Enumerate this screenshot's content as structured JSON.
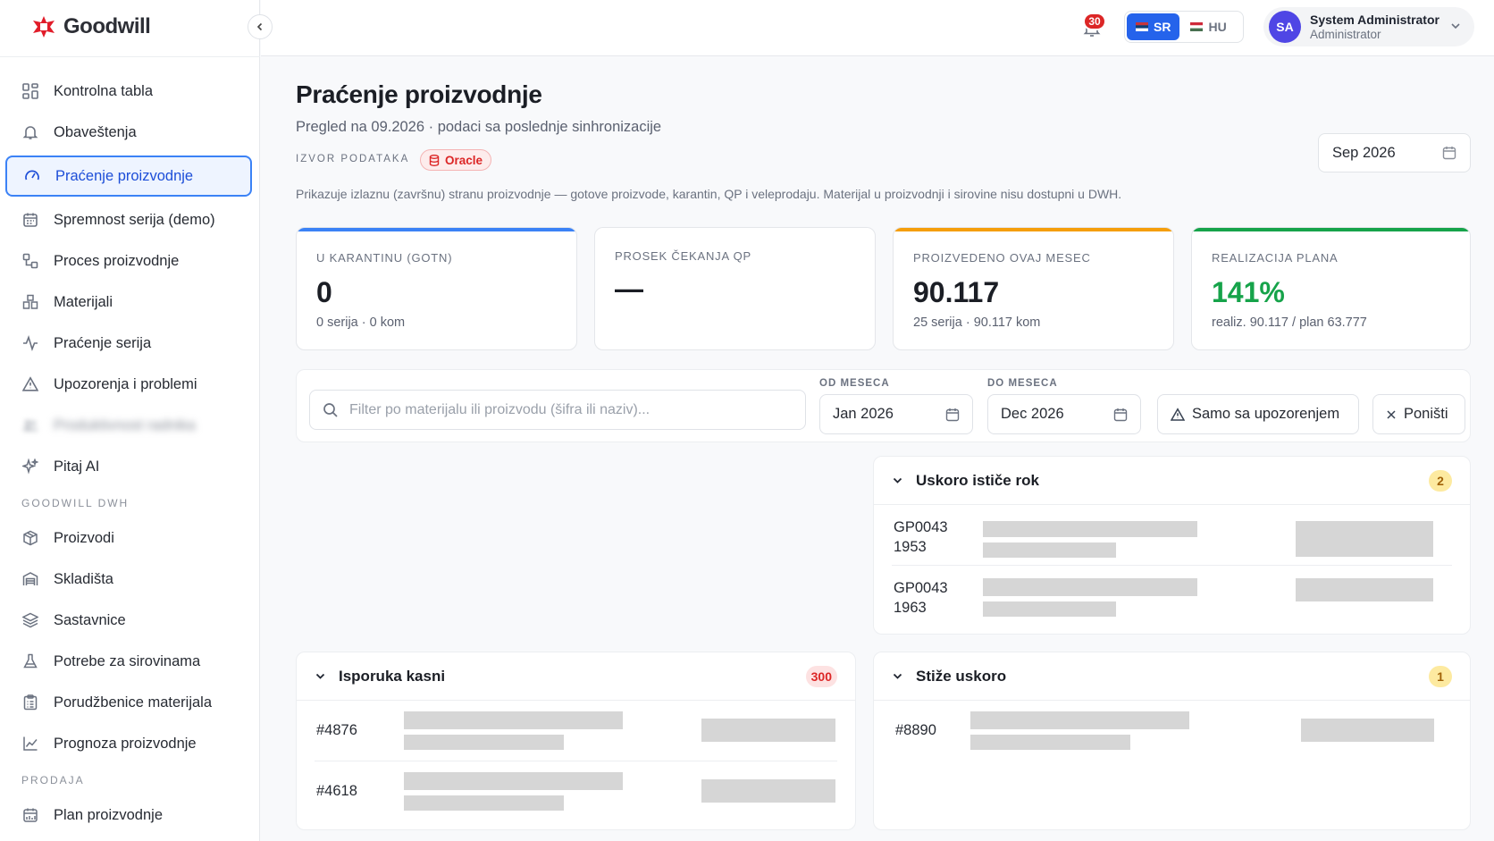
{
  "brand": {
    "name": "Goodwill"
  },
  "sidebar": {
    "items": [
      {
        "label": "Kontrolna tabla",
        "icon": "dashboard-grid-icon"
      },
      {
        "label": "Obaveštenja",
        "icon": "bell-icon"
      },
      {
        "label": "Praćenje proizvodnje",
        "icon": "gauge-icon",
        "active": true
      },
      {
        "label": "Spremnost serija (demo)",
        "icon": "calendar-icon"
      },
      {
        "label": "Proces proizvodnje",
        "icon": "workflow-icon"
      },
      {
        "label": "Materijali",
        "icon": "boxes-icon"
      },
      {
        "label": "Praćenje serija",
        "icon": "activity-icon"
      },
      {
        "label": "Upozorenja i problemi",
        "icon": "warning-triangle-icon"
      },
      {
        "label": "Produktivnost radnika",
        "icon": "users-icon",
        "blurred": true
      },
      {
        "label": "Pitaj AI",
        "icon": "sparkles-icon"
      }
    ],
    "section_dwh": "GOODWILL DWH",
    "dwh_items": [
      {
        "label": "Proizvodi",
        "icon": "package-icon"
      },
      {
        "label": "Skladišta",
        "icon": "warehouse-icon"
      },
      {
        "label": "Sastavnice",
        "icon": "layers-icon"
      },
      {
        "label": "Potrebe za sirovinama",
        "icon": "flask-icon"
      },
      {
        "label": "Porudžbenice materijala",
        "icon": "clipboard-icon"
      },
      {
        "label": "Prognoza proizvodnje",
        "icon": "line-chart-icon"
      }
    ],
    "section_sales": "PRODAJA",
    "sales_items": [
      {
        "label": "Plan proizvodnje",
        "icon": "calendar-chart-icon"
      }
    ]
  },
  "topbar": {
    "notifications_count": "30",
    "languages": [
      {
        "code": "SR",
        "active": true
      },
      {
        "code": "HU",
        "active": false
      }
    ],
    "user": {
      "initials": "SA",
      "name": "System Administrator",
      "role": "Administrator"
    }
  },
  "page": {
    "title": "Praćenje proizvodnje",
    "subtitle": "Pregled na 09.2026 · podaci sa poslednje sinhronizacije",
    "source_label": "IZVOR PODATAKA",
    "source_value": "Oracle",
    "description": "Prikazuje izlaznu (završnu) stranu proizvodnje — gotove proizvode, karantin, QP i veleprodaju. Materijal u proizvodnji i sirovine nisu dostupni u DWH.",
    "month": "Sep 2026"
  },
  "kpis": [
    {
      "label": "U KARANTINU (GOTN)",
      "value": "0",
      "sub": "0 serija · 0 kom",
      "accent": "#3b82f6",
      "value_color": "#1b1e25"
    },
    {
      "label": "PROSEK ČEKANJA QP",
      "value": "—",
      "sub": "",
      "accent": "",
      "value_color": "#1b1e25"
    },
    {
      "label": "PROIZVEDENO OVAJ MESEC",
      "value": "90.117",
      "sub": "25 serija · 90.117 kom",
      "accent": "#f59e0b",
      "value_color": "#1b1e25"
    },
    {
      "label": "REALIZACIJA PLANA",
      "value": "141%",
      "sub": "realiz. 90.117 / plan 63.777",
      "accent": "#16a34a",
      "value_color": "#16a34a"
    }
  ],
  "filters": {
    "search_placeholder": "Filter po materijalu ili proizvodu (šifra ili naziv)...",
    "from_label": "OD MESECA",
    "from_value": "Jan 2026",
    "to_label": "DO MESECA",
    "to_value": "Dec 2026",
    "warn_button": "Samo sa upozorenjem",
    "reset_button": "Poništi"
  },
  "panels": {
    "expiring": {
      "title": "Uskoro ističe rok",
      "count": "2",
      "rows": [
        {
          "id_line1": "GP0043",
          "id_line2": "1953"
        },
        {
          "id_line1": "GP0043",
          "id_line2": "1963"
        }
      ]
    },
    "late": {
      "title": "Isporuka kasni",
      "count": "300",
      "rows": [
        {
          "id": "#4876"
        },
        {
          "id": "#4618"
        }
      ]
    },
    "arriving": {
      "title": "Stiže uskoro",
      "count": "1",
      "rows": [
        {
          "id": "#8890"
        }
      ]
    }
  }
}
